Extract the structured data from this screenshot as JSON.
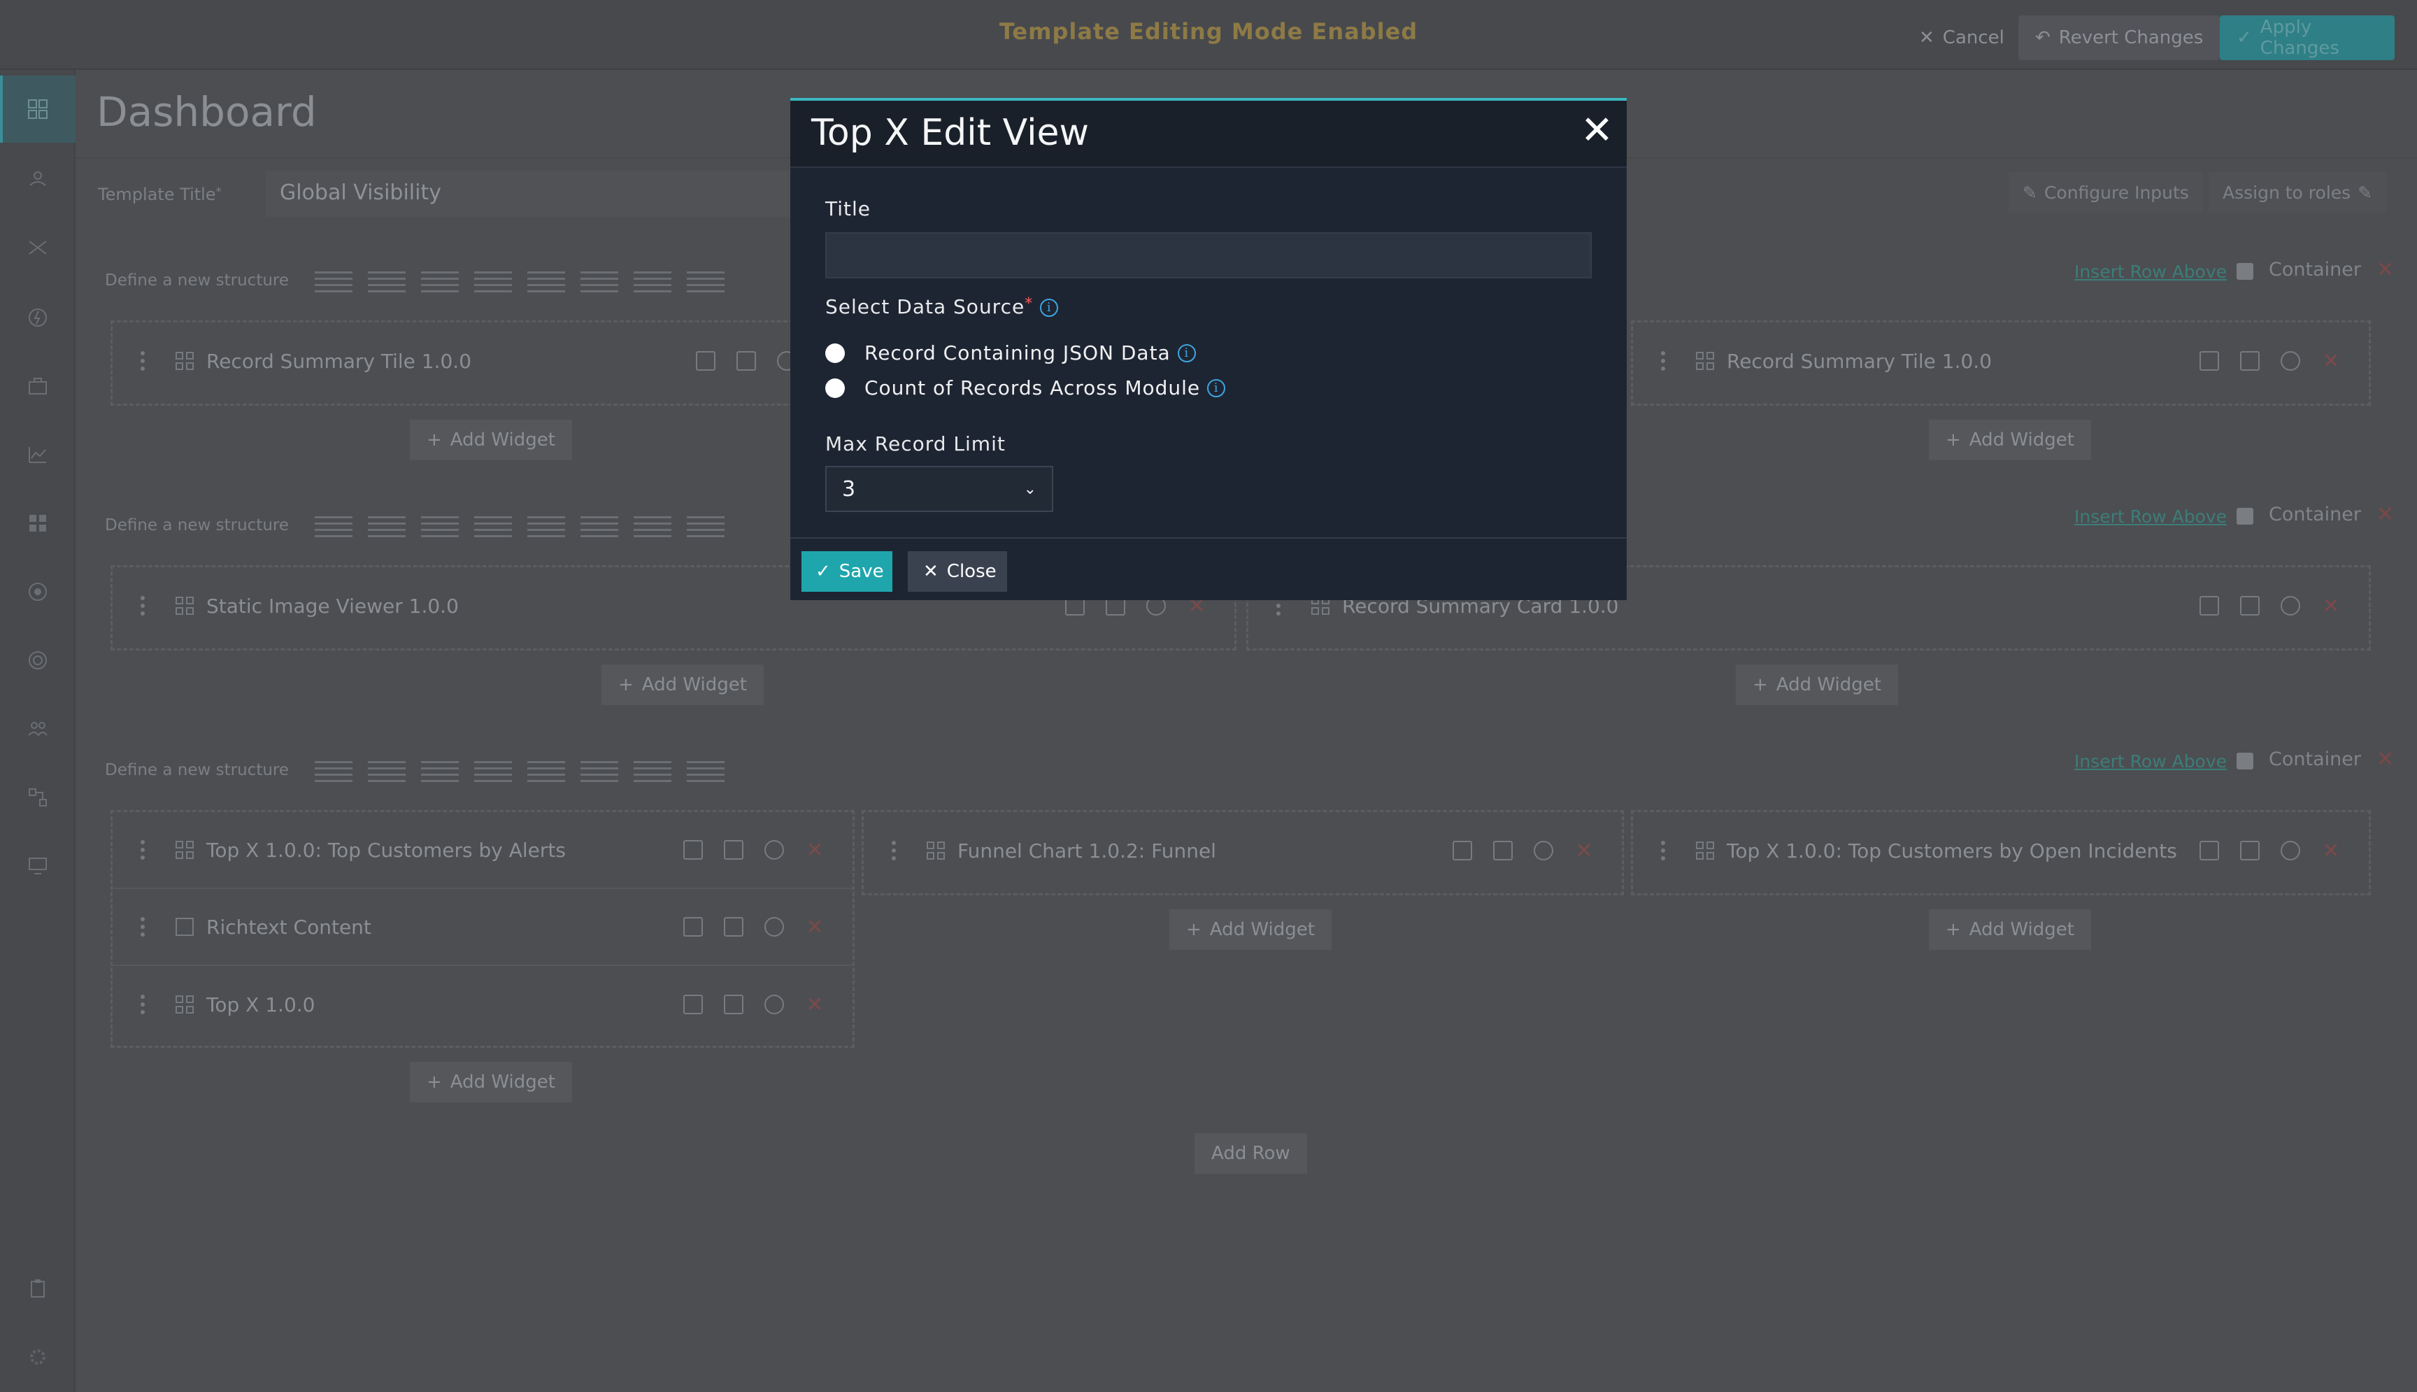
{
  "topbar": {
    "mode_text": "Template Editing Mode Enabled",
    "cancel": "Cancel",
    "revert": "Revert Changes",
    "apply": "Apply Changes"
  },
  "page": {
    "title": "Dashboard",
    "template_title_label": "Template Title",
    "template_title_required": "*",
    "template_title_value": "Global Visibility",
    "configure_inputs": "Configure Inputs",
    "assign_roles": "Assign to roles",
    "add_row": "Add Row"
  },
  "rows": [
    {
      "structure_label": "Define a new structure",
      "insert_above": "Insert Row Above",
      "container": "Container",
      "columns": [
        {
          "widgets": [
            "Record Summary Tile 1.0.0"
          ],
          "add_widget": "Add Widget"
        },
        {
          "widgets": [
            "Record Summary Tile 1.0.0"
          ],
          "add_widget": "Add Widget"
        }
      ]
    },
    {
      "structure_label": "Define a new structure",
      "insert_above": "Insert Row Above",
      "container": "Container",
      "columns": [
        {
          "widgets": [
            "Static Image Viewer 1.0.0"
          ],
          "add_widget": "Add Widget"
        },
        {
          "widgets": [
            "Record Summary Card 1.0.0"
          ],
          "add_widget": "Add Widget"
        }
      ]
    },
    {
      "structure_label": "Define a new structure",
      "insert_above": "Insert Row Above",
      "container": "Container",
      "columns": [
        {
          "widgets": [
            "Top X 1.0.0: Top Customers by Alerts",
            "Richtext Content",
            "Top X 1.0.0"
          ],
          "add_widget": "Add Widget"
        },
        {
          "widgets": [
            "Funnel Chart 1.0.2: Funnel"
          ],
          "add_widget": "Add Widget"
        },
        {
          "widgets": [
            "Top X 1.0.0: Top Customers by Open Incidents"
          ],
          "add_widget": "Add Widget"
        }
      ]
    }
  ],
  "modal": {
    "title": "Top X Edit View",
    "field_title_label": "Title",
    "field_title_value": "",
    "datasource_label": "Select Data Source",
    "datasource_required": "*",
    "options": [
      "Record Containing JSON Data",
      "Count of Records Across Module"
    ],
    "limit_label": "Max Record Limit",
    "limit_value": "3",
    "save": "Save",
    "close": "Close"
  },
  "colors": {
    "accent": "#1ea6ac",
    "modal_bg": "#1e2532",
    "overlay_bg": "#4c4e52"
  }
}
